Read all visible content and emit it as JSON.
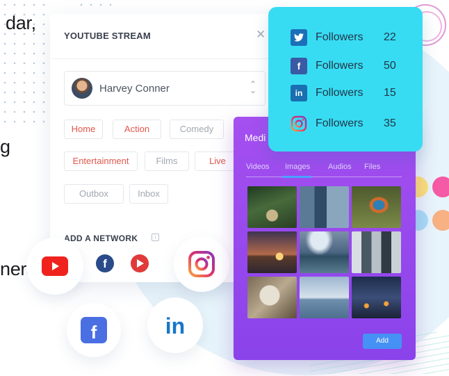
{
  "page_fragments": {
    "top_left": "dar,",
    "middle_left": "g",
    "bottom_left": "ners"
  },
  "stream_card": {
    "title": "YOUTUBE STREAM",
    "close_icon": "close-icon",
    "user": {
      "name": "Harvey Conner"
    },
    "tags": {
      "home": "Home",
      "action": "Action",
      "comedy": "Comedy",
      "entertainment": "Entertainment",
      "films": "Films",
      "live": "Live",
      "outbox": "Outbox",
      "inbox": "Inbox"
    },
    "network_title": "ADD A NETWORK"
  },
  "followers_card": {
    "rows": [
      {
        "network": "twitter",
        "icon": "twitter-icon",
        "label": "Followers",
        "count": "22",
        "color": "#1b95e0"
      },
      {
        "network": "facebook",
        "icon": "facebook-icon",
        "label": "Followers",
        "count": "50",
        "color": "#3b5998"
      },
      {
        "network": "linkedin",
        "icon": "linkedin-icon",
        "label": "Followers",
        "count": "15",
        "color": "#0077b5"
      },
      {
        "network": "instagram",
        "icon": "instagram-icon",
        "label": "Followers",
        "count": "35",
        "color": "#e1306c"
      }
    ]
  },
  "media_card": {
    "title": "Medi",
    "tabs": {
      "videos": "Videos",
      "images": "Images",
      "audios": "Audios",
      "files": "Files"
    },
    "active_tab": "Images",
    "thumbnails": [
      "forest-bridge",
      "business-handshake",
      "kingfisher-bird",
      "sunset-sea",
      "island-sea",
      "office-team",
      "desk-documents",
      "lake-dusk",
      "city-night"
    ],
    "add_label": "Add"
  },
  "colors": {
    "accent_cyan": "#37dcf3",
    "media_purple": "#9a4bee",
    "tag_red": "#e2574c",
    "button_blue": "#4691f5"
  }
}
